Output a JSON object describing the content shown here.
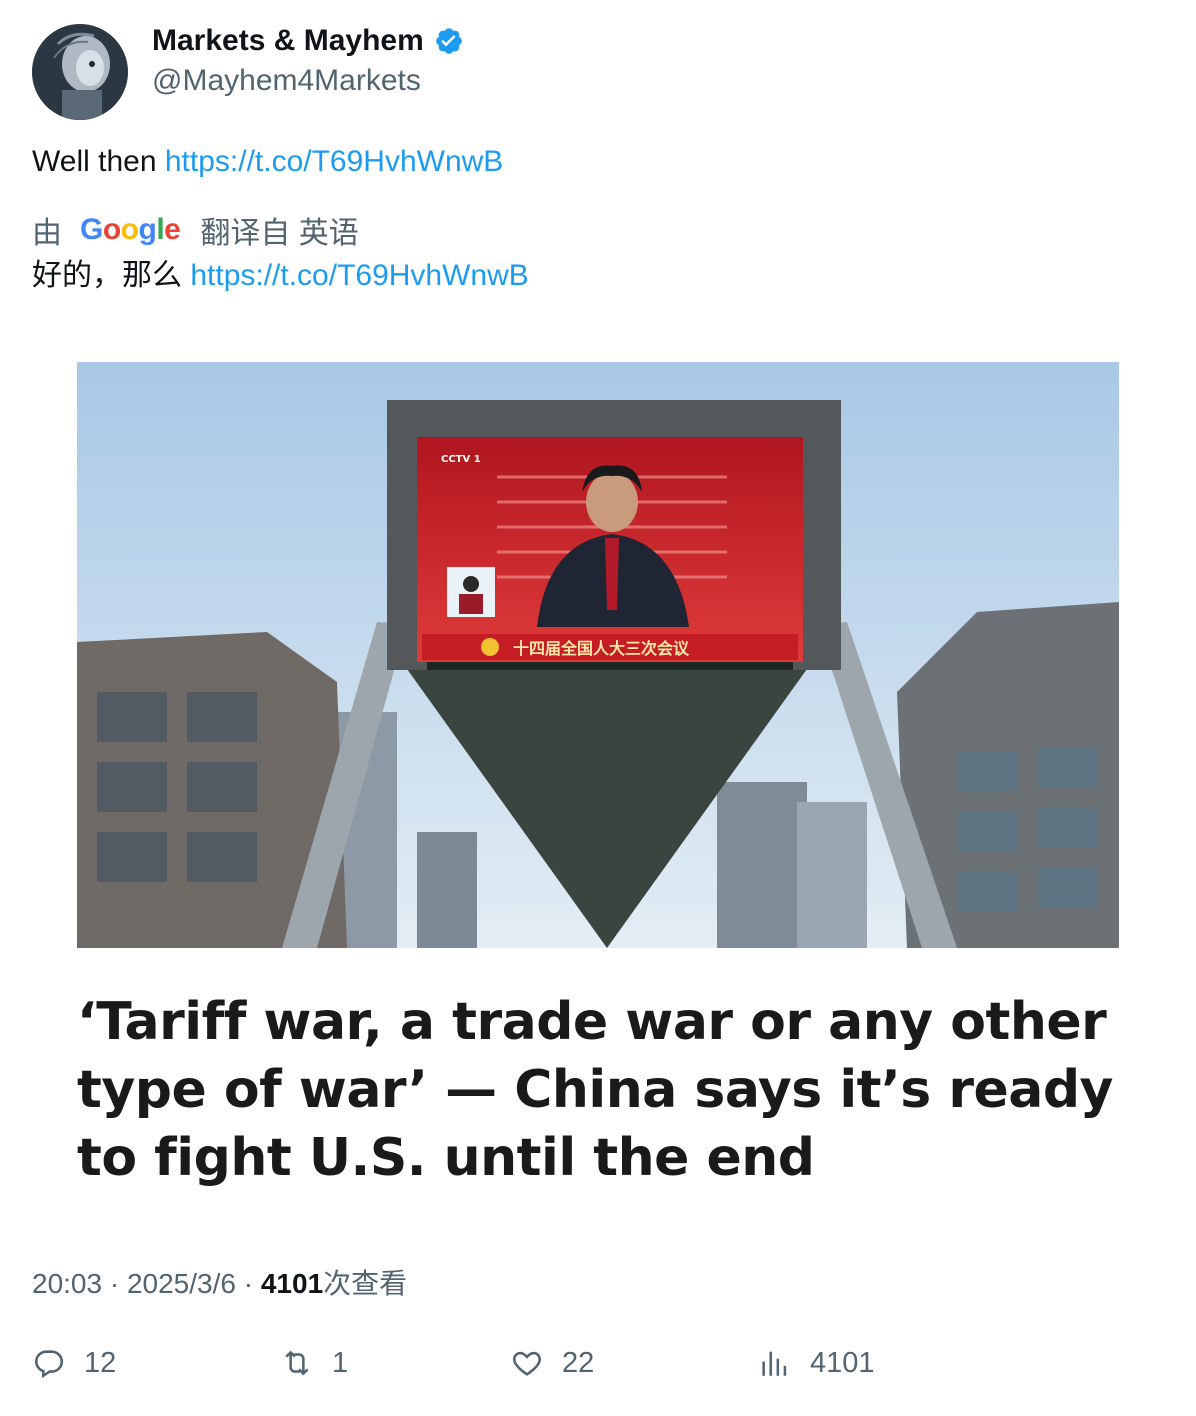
{
  "author": {
    "display_name": "Markets & Mayhem",
    "handle": "@Mayhem4Markets",
    "verified": true
  },
  "tweet": {
    "text": "Well then",
    "link": "https://t.co/T69HvhWnwB"
  },
  "translation": {
    "by_label": "由",
    "provider_letters": [
      "G",
      "o",
      "o",
      "g",
      "l",
      "e"
    ],
    "provider_colors": [
      "#4285F4",
      "#EA4335",
      "#FBBC05",
      "#4285F4",
      "#34A853",
      "#EA4335"
    ],
    "from_label": "翻译自 英语",
    "text": "好的，那么",
    "link": "https://t.co/T69HvhWnwB"
  },
  "card": {
    "screen_caption": "十四届全国人大三次会议",
    "headline": "‘Tariff war, a trade war or any other type of war’ — China says it’s ready to fight U.S. until the end"
  },
  "meta": {
    "time": "20:03",
    "sep": "·",
    "date": "2025/3/6",
    "views_count": "4101",
    "views_label": "次查看"
  },
  "actions": {
    "replies": "12",
    "reposts": "1",
    "likes": "22",
    "views": "4101"
  },
  "colors": {
    "link": "#1d9bf0",
    "secondary_text": "#536471",
    "verified_badge": "#1d9bf0"
  }
}
